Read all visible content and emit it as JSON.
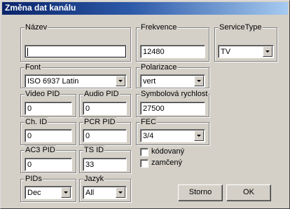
{
  "window": {
    "title": "Změna dat kanálu"
  },
  "fields": {
    "name": {
      "label": "Název",
      "value": ""
    },
    "frequency": {
      "label": "Frekvence",
      "value": "12480"
    },
    "service_type": {
      "label": "ServiceType",
      "value": "TV"
    },
    "font": {
      "label": "Font",
      "value": "ISO 6937 Latin"
    },
    "polarization": {
      "label": "Polarizace",
      "value": "vert"
    },
    "video_pid": {
      "label": "Video PID",
      "value": "0"
    },
    "audio_pid": {
      "label": "Audio PID",
      "value": "0"
    },
    "symbol_rate": {
      "label": "Symbolová rychlost",
      "value": "27500"
    },
    "ch_id": {
      "label": "Ch. ID",
      "value": "0"
    },
    "pcr_pid": {
      "label": "PCR PID",
      "value": "0"
    },
    "fec": {
      "label": "FEC",
      "value": "3/4"
    },
    "ac3_pid": {
      "label": "AC3 PID",
      "value": "0"
    },
    "ts_id": {
      "label": "TS ID",
      "value": "33"
    },
    "pids": {
      "label": "PIDs",
      "value": "Dec"
    },
    "language": {
      "label": "Jazyk",
      "value": "All"
    }
  },
  "checkboxes": {
    "encrypted": {
      "label": "kódovaný",
      "checked": false
    },
    "locked": {
      "label": "zamčený",
      "checked": false
    }
  },
  "buttons": {
    "cancel": "Storno",
    "ok": "OK"
  }
}
